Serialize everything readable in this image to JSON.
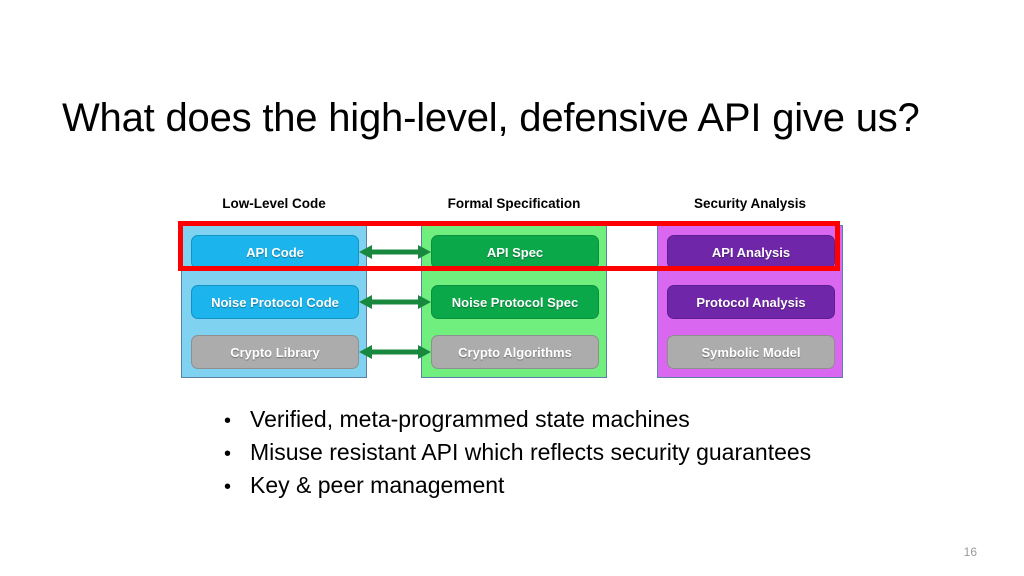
{
  "slide": {
    "title": "What does the high-level, defensive API give us?",
    "page_number": "16"
  },
  "diagram": {
    "columns": [
      {
        "header": "Low-Level Code",
        "panel_color": "#7fd3f0",
        "nodes": [
          {
            "label": "API Code",
            "color": "#1bb4ec"
          },
          {
            "label": "Noise Protocol Code",
            "color": "#1bb4ec"
          },
          {
            "label": "Crypto Library",
            "color": "#acacac"
          }
        ]
      },
      {
        "header": "Formal Specification",
        "panel_color": "#70ef7f",
        "nodes": [
          {
            "label": "API Spec",
            "color": "#0ba84a"
          },
          {
            "label": "Noise Protocol Spec",
            "color": "#0ba84a"
          },
          {
            "label": "Crypto Algorithms",
            "color": "#acacac"
          }
        ]
      },
      {
        "header": "Security Analysis",
        "panel_color": "#d967f0",
        "nodes": [
          {
            "label": "API Analysis",
            "color": "#7026a8"
          },
          {
            "label": "Protocol Analysis",
            "color": "#7026a8"
          },
          {
            "label": "Symbolic Model",
            "color": "#acacac"
          }
        ]
      }
    ],
    "connectors": {
      "icon": "double-arrow-icon",
      "color": "#18883f",
      "count": 3
    },
    "highlight": {
      "name": "red-highlight-rectangle",
      "color": "#fe0000",
      "targets": "top row"
    }
  },
  "bullets": {
    "marker": "•",
    "items": [
      "Verified, meta-programmed state machines",
      "Misuse resistant API which reflects security guarantees",
      "Key & peer management"
    ]
  }
}
